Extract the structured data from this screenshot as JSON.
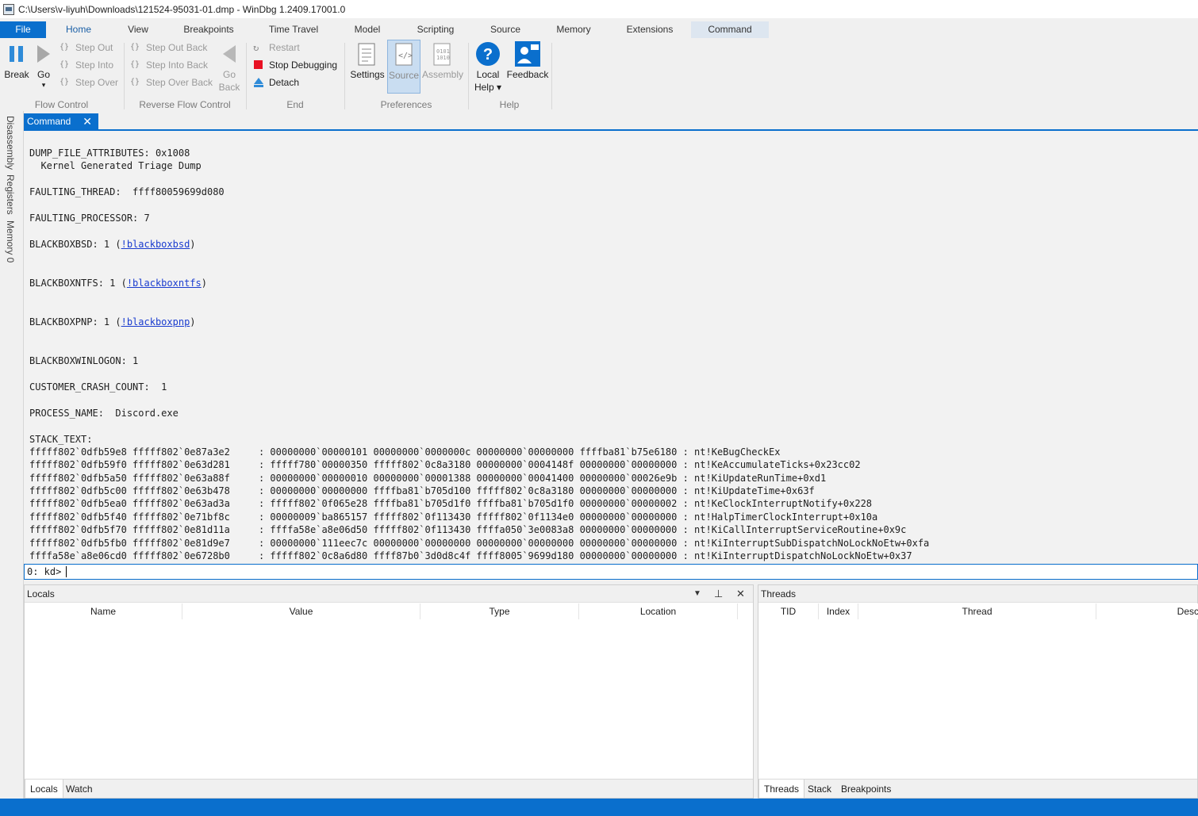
{
  "window": {
    "title": "C:\\Users\\v-liyuh\\Downloads\\121524-95031-01.dmp - WinDbg 1.2409.17001.0"
  },
  "menu": {
    "file": "File",
    "home": "Home",
    "view": "View",
    "breakpoints": "Breakpoints",
    "time_travel": "Time Travel",
    "model": "Model",
    "scripting": "Scripting",
    "source": "Source",
    "memory": "Memory",
    "extensions": "Extensions",
    "command": "Command"
  },
  "ribbon": {
    "break": "Break",
    "go": "Go",
    "go_arrow": "▾",
    "step_out": "Step Out",
    "step_into": "Step Into",
    "step_over": "Step Over",
    "step_out_back": "Step Out Back",
    "step_into_back": "Step Into Back",
    "step_over_back": "Step Over Back",
    "go_back_1": "Go",
    "go_back_2": "Back",
    "restart": "Restart",
    "stop_debugging": "Stop Debugging",
    "detach": "Detach",
    "settings": "Settings",
    "source": "Source",
    "assembly": "Assembly",
    "local_help_1": "Local",
    "local_help_2": "Help ▾",
    "feedback": "Feedback",
    "groups": {
      "flow_control": "Flow Control",
      "reverse_flow_control": "Reverse Flow Control",
      "end": "End",
      "preferences": "Preferences",
      "help": "Help"
    }
  },
  "side_tabs": {
    "disassembly": "Disassembly",
    "registers": "Registers",
    "memory0": "Memory 0"
  },
  "command_tab": {
    "label": "Command",
    "close": "✕"
  },
  "output": {
    "dump_file_attributes": "DUMP_FILE_ATTRIBUTES: 0x1008",
    "kernel_generated": "  Kernel Generated Triage Dump",
    "faulting_thread": "FAULTING_THREAD:  ffff80059699d080",
    "faulting_processor": "FAULTING_PROCESSOR: 7",
    "blackboxbsd_pre": "BLACKBOXBSD: 1 (",
    "blackboxbsd_link": "!blackboxbsd",
    "blackboxntfs_pre": "BLACKBOXNTFS: 1 (",
    "blackboxntfs_link": "!blackboxntfs",
    "blackboxpnp_pre": "BLACKBOXPNP: 1 (",
    "blackboxpnp_link": "!blackboxpnp",
    "close_paren": ")",
    "blackboxwinlogon": "BLACKBOXWINLOGON: 1",
    "customer_crash_count": "CUSTOMER_CRASH_COUNT:  1",
    "process_name": "PROCESS_NAME:  Discord.exe",
    "stack_text": "STACK_TEXT:",
    "stack": [
      "fffff802`0dfb59e8 fffff802`0e87a3e2     : 00000000`00000101 00000000`0000000c 00000000`00000000 ffffba81`b75e6180 : nt!KeBugCheckEx",
      "fffff802`0dfb59f0 fffff802`0e63d281     : fffff780`00000350 fffff802`0c8a3180 00000000`0004148f 00000000`00000000 : nt!KeAccumulateTicks+0x23cc02",
      "fffff802`0dfb5a50 fffff802`0e63a88f     : 00000000`00000010 00000000`00001388 00000000`00041400 00000000`00026e9b : nt!KiUpdateRunTime+0xd1",
      "fffff802`0dfb5c00 fffff802`0e63b478     : 00000000`00000000 ffffba81`b705d100 fffff802`0c8a3180 00000000`00000000 : nt!KiUpdateTime+0x63f",
      "fffff802`0dfb5ea0 fffff802`0e63ad3a     : fffff802`0f065e28 ffffba81`b705d1f0 ffffba81`b705d1f0 00000000`00000002 : nt!KeClockInterruptNotify+0x228",
      "fffff802`0dfb5f40 fffff802`0e71bf8c     : 00000009`ba865157 fffff802`0f113430 fffff802`0f1134e0 00000000`00000000 : nt!HalpTimerClockInterrupt+0x10a",
      "fffff802`0dfb5f70 fffff802`0e81d11a     : ffffa58e`a8e06d50 fffff802`0f113430 ffffa050`3e0083a8 00000000`00000000 : nt!KiCallInterruptServiceRoutine+0x9c",
      "fffff802`0dfb5fb0 fffff802`0e81d9e7     : 00000000`111eec7c 00000000`00000000 00000000`00000000 00000000`00000000 : nt!KiInterruptSubDispatchNoLockNoEtw+0xfa",
      "ffffa58e`a8e06cd0 fffff802`0e6728b0     : fffff802`0c8a6d80 ffff87b0`3d0d8c4f ffff8005`9699d180 00000000`00000000 : nt!KiInterruptDispatchNoLockNoEtw+0x37"
    ]
  },
  "prompt": {
    "label": "0: kd>",
    "value": ""
  },
  "locals_pane": {
    "title": "Locals",
    "columns": [
      "Name",
      "Value",
      "Type",
      "Location"
    ],
    "tabs": [
      "Locals",
      "Watch"
    ]
  },
  "threads_pane": {
    "title": "Threads",
    "columns": [
      "TID",
      "Index",
      "Thread",
      "Desc"
    ],
    "tabs": [
      "Threads",
      "Stack",
      "Breakpoints"
    ]
  },
  "colors": {
    "accent": "#0a6fcd",
    "link": "#1a3ccf",
    "stop": "#e81123"
  },
  "icons": [
    "pause-icon",
    "play-icon",
    "step-out-icon",
    "step-into-icon",
    "step-over-icon",
    "back-arrow-icon",
    "restart-icon",
    "stop-icon",
    "detach-icon",
    "settings-icon",
    "source-icon",
    "assembly-icon",
    "help-icon",
    "feedback-icon",
    "close-icon",
    "dropdown-icon",
    "pin-icon"
  ]
}
